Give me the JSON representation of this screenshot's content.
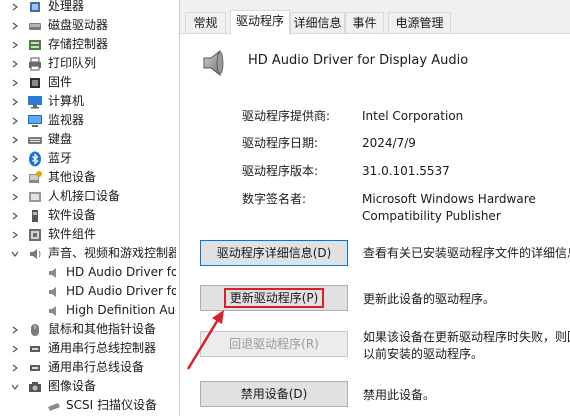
{
  "tree": {
    "items": [
      {
        "label": "处理器",
        "icon": "processor-icon",
        "expanded": false
      },
      {
        "label": "磁盘驱动器",
        "icon": "disk-drive-icon",
        "expanded": false
      },
      {
        "label": "存储控制器",
        "icon": "storage-controller-icon",
        "expanded": false
      },
      {
        "label": "打印队列",
        "icon": "printer-icon",
        "expanded": false
      },
      {
        "label": "固件",
        "icon": "firmware-icon",
        "expanded": false
      },
      {
        "label": "计算机",
        "icon": "computer-icon",
        "expanded": false
      },
      {
        "label": "监视器",
        "icon": "monitor-icon",
        "expanded": false
      },
      {
        "label": "键盘",
        "icon": "keyboard-icon",
        "expanded": false
      },
      {
        "label": "蓝牙",
        "icon": "bluetooth-icon",
        "expanded": false
      },
      {
        "label": "其他设备",
        "icon": "other-devices-icon",
        "expanded": false
      },
      {
        "label": "人机接口设备",
        "icon": "hid-icon",
        "expanded": false
      },
      {
        "label": "软件设备",
        "icon": "software-device-icon",
        "expanded": false
      },
      {
        "label": "软件组件",
        "icon": "software-component-icon",
        "expanded": false
      },
      {
        "label": "声音、视频和游戏控制器",
        "icon": "sound-icon",
        "expanded": true
      },
      {
        "label": "HD Audio Driver for",
        "icon": "speaker-icon",
        "child": true
      },
      {
        "label": "HD Audio Driver for",
        "icon": "speaker-icon",
        "child": true
      },
      {
        "label": "High Definition Audi",
        "icon": "speaker-icon",
        "child": true
      },
      {
        "label": "鼠标和其他指针设备",
        "icon": "mouse-icon",
        "expanded": false
      },
      {
        "label": "通用串行总线控制器",
        "icon": "usb-icon",
        "expanded": false
      },
      {
        "label": "通用串行总线设备",
        "icon": "usb-device-icon",
        "expanded": false
      },
      {
        "label": "图像设备",
        "icon": "imaging-device-icon",
        "expanded": true
      },
      {
        "label": "SCSI 扫描仪设备",
        "icon": "scanner-icon",
        "child": true
      }
    ]
  },
  "properties": {
    "tabs": [
      {
        "label": "常规",
        "active": false
      },
      {
        "label": "驱动程序",
        "active": true
      },
      {
        "label": "详细信息",
        "active": false
      },
      {
        "label": "事件",
        "active": false
      },
      {
        "label": "电源管理",
        "active": false
      }
    ],
    "device_name": "HD Audio Driver for Display Audio",
    "fields": [
      {
        "label": "驱动程序提供商:",
        "value": "Intel Corporation"
      },
      {
        "label": "驱动程序日期:",
        "value": "2024/7/9"
      },
      {
        "label": "驱动程序版本:",
        "value": "31.0.101.5537"
      },
      {
        "label": "数字签名者:",
        "value_line1": "Microsoft Windows Hardware",
        "value_line2": "Compatibility Publisher"
      }
    ],
    "buttons": [
      {
        "label": "驱动程序详细信息(D)",
        "desc": "查看有关已安装驱动程序文件的详细信息。"
      },
      {
        "label": "更新驱动程序(P)",
        "desc": "更新此设备的驱动程序。"
      },
      {
        "label": "回退驱动程序(R)",
        "desc_line1": "如果该设备在更新驱动程序时失败，则回",
        "desc_line2": "以前安装的驱动程序。"
      },
      {
        "label": "禁用设备(D)",
        "desc": "禁用此设备。"
      }
    ]
  },
  "colors": {
    "highlight_red": "#d9202a",
    "focus_blue": "#0078d7",
    "panel_bg": "#f0f0f0"
  }
}
